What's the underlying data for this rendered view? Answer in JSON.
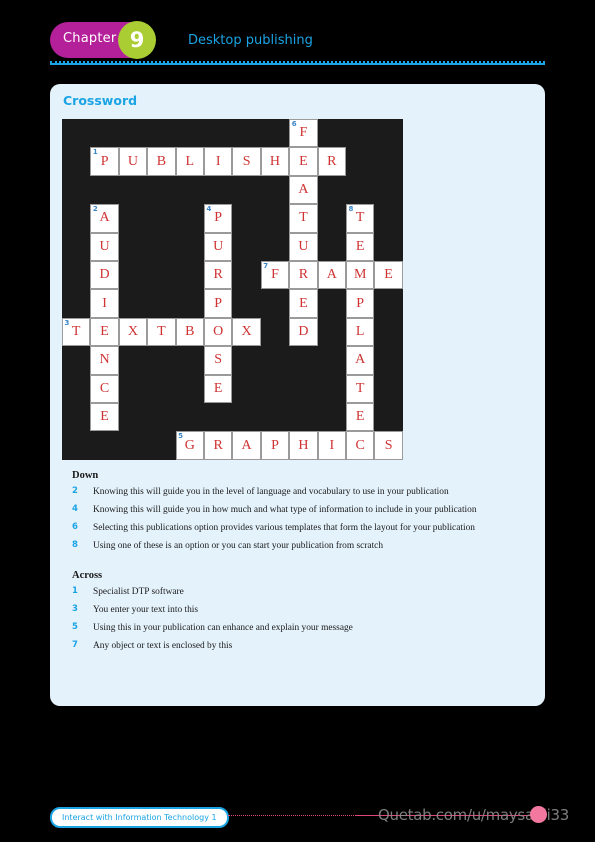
{
  "header": {
    "chapter_label": "Chapter",
    "chapter_number": "9",
    "chapter_title": "Desktop publishing",
    "accent_magenta": "#b4209a",
    "accent_green": "#a9cd33",
    "accent_blue": "#1ba4e4"
  },
  "panel": {
    "title": "Crossword",
    "background": "#e4f2fb"
  },
  "crossword": {
    "columns": 12,
    "rows": 12,
    "cell_size": 28.4,
    "letter_color": "#cf3333",
    "number_color": "#3a85c6",
    "block_color": "#1c1b1b",
    "cells": [
      {
        "r": 0,
        "c": 8,
        "l": "F",
        "n": "6"
      },
      {
        "r": 1,
        "c": 1,
        "l": "P",
        "n": "1"
      },
      {
        "r": 1,
        "c": 2,
        "l": "U"
      },
      {
        "r": 1,
        "c": 3,
        "l": "B"
      },
      {
        "r": 1,
        "c": 4,
        "l": "L"
      },
      {
        "r": 1,
        "c": 5,
        "l": "I"
      },
      {
        "r": 1,
        "c": 6,
        "l": "S"
      },
      {
        "r": 1,
        "c": 7,
        "l": "H"
      },
      {
        "r": 1,
        "c": 8,
        "l": "E"
      },
      {
        "r": 1,
        "c": 9,
        "l": "R"
      },
      {
        "r": 2,
        "c": 8,
        "l": "A"
      },
      {
        "r": 3,
        "c": 1,
        "l": "A",
        "n": "2"
      },
      {
        "r": 3,
        "c": 5,
        "l": "P",
        "n": "4"
      },
      {
        "r": 3,
        "c": 8,
        "l": "T"
      },
      {
        "r": 3,
        "c": 10,
        "l": "T",
        "n": "8"
      },
      {
        "r": 4,
        "c": 1,
        "l": "U"
      },
      {
        "r": 4,
        "c": 5,
        "l": "U"
      },
      {
        "r": 4,
        "c": 8,
        "l": "U"
      },
      {
        "r": 4,
        "c": 10,
        "l": "E"
      },
      {
        "r": 5,
        "c": 1,
        "l": "D"
      },
      {
        "r": 5,
        "c": 5,
        "l": "R"
      },
      {
        "r": 5,
        "c": 7,
        "l": "F",
        "n": "7"
      },
      {
        "r": 5,
        "c": 8,
        "l": "R"
      },
      {
        "r": 5,
        "c": 9,
        "l": "A"
      },
      {
        "r": 5,
        "c": 10,
        "l": "M"
      },
      {
        "r": 5,
        "c": 11,
        "l": "E"
      },
      {
        "r": 6,
        "c": 1,
        "l": "I"
      },
      {
        "r": 6,
        "c": 5,
        "l": "P"
      },
      {
        "r": 6,
        "c": 8,
        "l": "E"
      },
      {
        "r": 6,
        "c": 10,
        "l": "P"
      },
      {
        "r": 7,
        "c": 0,
        "l": "T",
        "n": "3"
      },
      {
        "r": 7,
        "c": 1,
        "l": "E"
      },
      {
        "r": 7,
        "c": 2,
        "l": "X"
      },
      {
        "r": 7,
        "c": 3,
        "l": "T"
      },
      {
        "r": 7,
        "c": 4,
        "l": "B"
      },
      {
        "r": 7,
        "c": 5,
        "l": "O"
      },
      {
        "r": 7,
        "c": 6,
        "l": "X"
      },
      {
        "r": 7,
        "c": 8,
        "l": "D"
      },
      {
        "r": 7,
        "c": 10,
        "l": "L"
      },
      {
        "r": 8,
        "c": 1,
        "l": "N"
      },
      {
        "r": 8,
        "c": 5,
        "l": "S"
      },
      {
        "r": 8,
        "c": 10,
        "l": "A"
      },
      {
        "r": 9,
        "c": 1,
        "l": "C"
      },
      {
        "r": 9,
        "c": 5,
        "l": "E"
      },
      {
        "r": 9,
        "c": 10,
        "l": "T"
      },
      {
        "r": 10,
        "c": 1,
        "l": "E"
      },
      {
        "r": 10,
        "c": 10,
        "l": "E"
      },
      {
        "r": 11,
        "c": 4,
        "l": "G",
        "n": "5"
      },
      {
        "r": 11,
        "c": 5,
        "l": "R"
      },
      {
        "r": 11,
        "c": 6,
        "l": "A"
      },
      {
        "r": 11,
        "c": 7,
        "l": "P"
      },
      {
        "r": 11,
        "c": 8,
        "l": "H"
      },
      {
        "r": 11,
        "c": 9,
        "l": "I"
      },
      {
        "r": 11,
        "c": 10,
        "l": "C"
      },
      {
        "r": 11,
        "c": 11,
        "l": "S"
      }
    ]
  },
  "clues": {
    "down_heading": "Down",
    "down": [
      {
        "num": "2",
        "text": "Knowing this will guide you in the level of language and vocabulary to use in your publication"
      },
      {
        "num": "4",
        "text": "Knowing this will guide you in how much and what type of information to include in your publication"
      },
      {
        "num": "6",
        "text": "Selecting this publications option provides various templates that form the layout for your publication"
      },
      {
        "num": "8",
        "text": "Using one of these is an option or you can start your publication from scratch"
      }
    ],
    "across_heading": "Across",
    "across": [
      {
        "num": "1",
        "text": "Specialist DTP software"
      },
      {
        "num": "3",
        "text": "You enter your text into this"
      },
      {
        "num": "5",
        "text": "Using this in your publication can enhance and explain your message"
      },
      {
        "num": "7",
        "text": "Any object or text is enclosed by this"
      }
    ]
  },
  "footer": {
    "book_title": "Interact with Information Technology 1",
    "watermark": "Quetab.com/u/maysaali33",
    "rule_color": "#e0457b"
  }
}
